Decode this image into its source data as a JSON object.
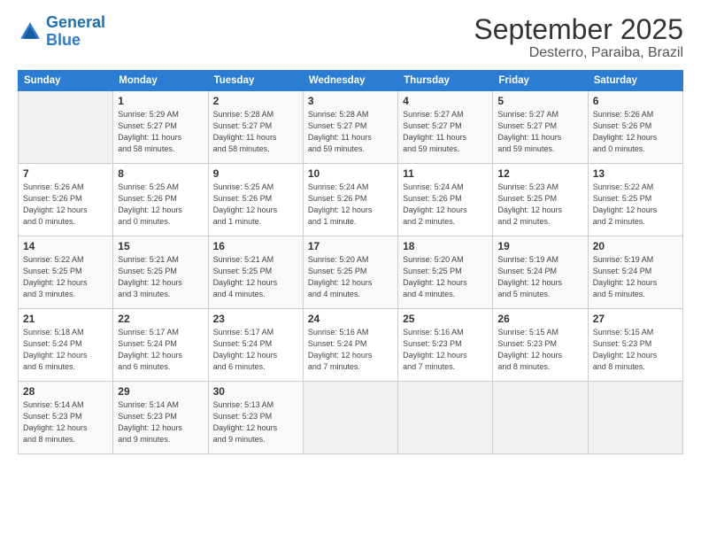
{
  "header": {
    "logo_line1": "General",
    "logo_line2": "Blue",
    "title": "September 2025",
    "subtitle": "Desterro, Paraiba, Brazil"
  },
  "days_of_week": [
    "Sunday",
    "Monday",
    "Tuesday",
    "Wednesday",
    "Thursday",
    "Friday",
    "Saturday"
  ],
  "weeks": [
    [
      {
        "day": "",
        "content": ""
      },
      {
        "day": "1",
        "content": "Sunrise: 5:29 AM\nSunset: 5:27 PM\nDaylight: 11 hours\nand 58 minutes."
      },
      {
        "day": "2",
        "content": "Sunrise: 5:28 AM\nSunset: 5:27 PM\nDaylight: 11 hours\nand 58 minutes."
      },
      {
        "day": "3",
        "content": "Sunrise: 5:28 AM\nSunset: 5:27 PM\nDaylight: 11 hours\nand 59 minutes."
      },
      {
        "day": "4",
        "content": "Sunrise: 5:27 AM\nSunset: 5:27 PM\nDaylight: 11 hours\nand 59 minutes."
      },
      {
        "day": "5",
        "content": "Sunrise: 5:27 AM\nSunset: 5:27 PM\nDaylight: 11 hours\nand 59 minutes."
      },
      {
        "day": "6",
        "content": "Sunrise: 5:26 AM\nSunset: 5:26 PM\nDaylight: 12 hours\nand 0 minutes."
      }
    ],
    [
      {
        "day": "7",
        "content": "Sunrise: 5:26 AM\nSunset: 5:26 PM\nDaylight: 12 hours\nand 0 minutes."
      },
      {
        "day": "8",
        "content": "Sunrise: 5:25 AM\nSunset: 5:26 PM\nDaylight: 12 hours\nand 0 minutes."
      },
      {
        "day": "9",
        "content": "Sunrise: 5:25 AM\nSunset: 5:26 PM\nDaylight: 12 hours\nand 1 minute."
      },
      {
        "day": "10",
        "content": "Sunrise: 5:24 AM\nSunset: 5:26 PM\nDaylight: 12 hours\nand 1 minute."
      },
      {
        "day": "11",
        "content": "Sunrise: 5:24 AM\nSunset: 5:26 PM\nDaylight: 12 hours\nand 2 minutes."
      },
      {
        "day": "12",
        "content": "Sunrise: 5:23 AM\nSunset: 5:25 PM\nDaylight: 12 hours\nand 2 minutes."
      },
      {
        "day": "13",
        "content": "Sunrise: 5:22 AM\nSunset: 5:25 PM\nDaylight: 12 hours\nand 2 minutes."
      }
    ],
    [
      {
        "day": "14",
        "content": "Sunrise: 5:22 AM\nSunset: 5:25 PM\nDaylight: 12 hours\nand 3 minutes."
      },
      {
        "day": "15",
        "content": "Sunrise: 5:21 AM\nSunset: 5:25 PM\nDaylight: 12 hours\nand 3 minutes."
      },
      {
        "day": "16",
        "content": "Sunrise: 5:21 AM\nSunset: 5:25 PM\nDaylight: 12 hours\nand 4 minutes."
      },
      {
        "day": "17",
        "content": "Sunrise: 5:20 AM\nSunset: 5:25 PM\nDaylight: 12 hours\nand 4 minutes."
      },
      {
        "day": "18",
        "content": "Sunrise: 5:20 AM\nSunset: 5:25 PM\nDaylight: 12 hours\nand 4 minutes."
      },
      {
        "day": "19",
        "content": "Sunrise: 5:19 AM\nSunset: 5:24 PM\nDaylight: 12 hours\nand 5 minutes."
      },
      {
        "day": "20",
        "content": "Sunrise: 5:19 AM\nSunset: 5:24 PM\nDaylight: 12 hours\nand 5 minutes."
      }
    ],
    [
      {
        "day": "21",
        "content": "Sunrise: 5:18 AM\nSunset: 5:24 PM\nDaylight: 12 hours\nand 6 minutes."
      },
      {
        "day": "22",
        "content": "Sunrise: 5:17 AM\nSunset: 5:24 PM\nDaylight: 12 hours\nand 6 minutes."
      },
      {
        "day": "23",
        "content": "Sunrise: 5:17 AM\nSunset: 5:24 PM\nDaylight: 12 hours\nand 6 minutes."
      },
      {
        "day": "24",
        "content": "Sunrise: 5:16 AM\nSunset: 5:24 PM\nDaylight: 12 hours\nand 7 minutes."
      },
      {
        "day": "25",
        "content": "Sunrise: 5:16 AM\nSunset: 5:23 PM\nDaylight: 12 hours\nand 7 minutes."
      },
      {
        "day": "26",
        "content": "Sunrise: 5:15 AM\nSunset: 5:23 PM\nDaylight: 12 hours\nand 8 minutes."
      },
      {
        "day": "27",
        "content": "Sunrise: 5:15 AM\nSunset: 5:23 PM\nDaylight: 12 hours\nand 8 minutes."
      }
    ],
    [
      {
        "day": "28",
        "content": "Sunrise: 5:14 AM\nSunset: 5:23 PM\nDaylight: 12 hours\nand 8 minutes."
      },
      {
        "day": "29",
        "content": "Sunrise: 5:14 AM\nSunset: 5:23 PM\nDaylight: 12 hours\nand 9 minutes."
      },
      {
        "day": "30",
        "content": "Sunrise: 5:13 AM\nSunset: 5:23 PM\nDaylight: 12 hours\nand 9 minutes."
      },
      {
        "day": "",
        "content": ""
      },
      {
        "day": "",
        "content": ""
      },
      {
        "day": "",
        "content": ""
      },
      {
        "day": "",
        "content": ""
      }
    ]
  ]
}
